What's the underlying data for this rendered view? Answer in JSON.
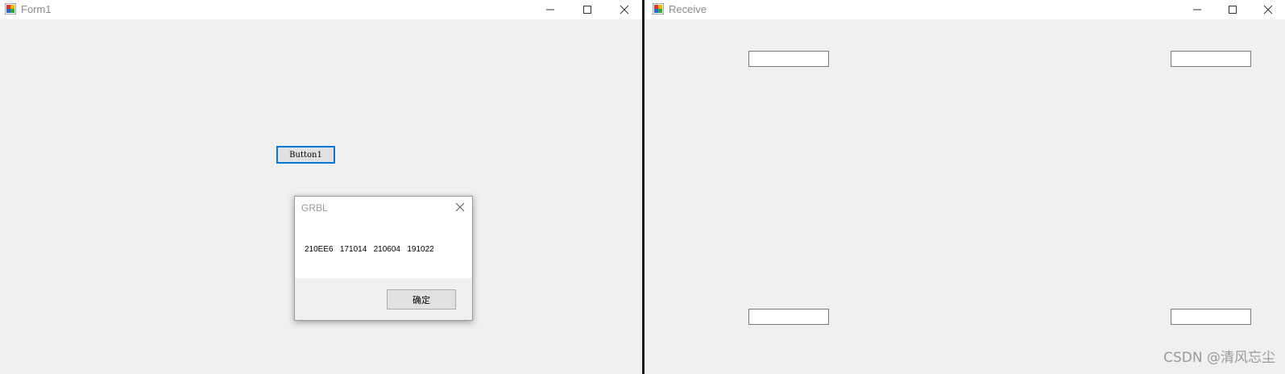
{
  "form1": {
    "title": "Form1",
    "button1_label": "Button1"
  },
  "receive": {
    "title": "Receive"
  },
  "msgbox": {
    "title": "GRBL",
    "message": "210EE6   171014   210604   191022",
    "ok_label": "确定"
  },
  "watermark": "CSDN @清风忘尘",
  "colors": {
    "window_bg": "#f0f0f0",
    "titlebar_bg": "#ffffff",
    "focus_border": "#0078d7"
  }
}
